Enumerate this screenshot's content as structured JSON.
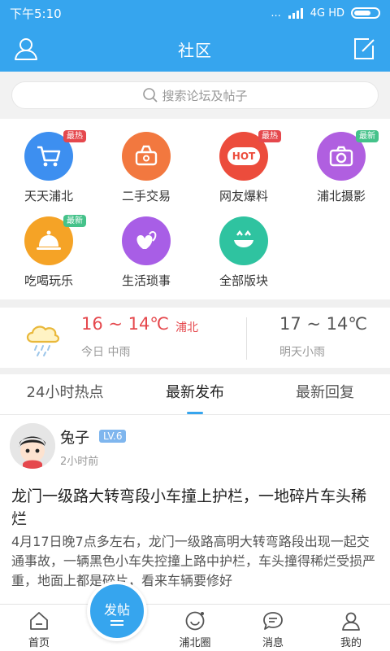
{
  "status_bar": {
    "time": "下午5:10",
    "dots": "...",
    "network": "4G HD"
  },
  "app_bar": {
    "title": "社区",
    "left_icon": "user-icon",
    "right_icon": "edit-icon"
  },
  "search": {
    "placeholder": "搜索论坛及帖子"
  },
  "forums": [
    {
      "label": "天天浦北",
      "badge": "最热",
      "icon": "cart-icon",
      "color": "#3d8ff0"
    },
    {
      "label": "二手交易",
      "badge": "",
      "icon": "basket-icon",
      "color": "#f2783f"
    },
    {
      "label": "网友爆料",
      "badge": "最热",
      "icon": "hot-icon",
      "color": "#ec4c3c",
      "icon_text": "HOT"
    },
    {
      "label": "浦北摄影",
      "badge": "最新",
      "icon": "camera-icon",
      "color": "#b05fe0"
    },
    {
      "label": "吃喝玩乐",
      "badge": "最新",
      "icon": "food-cloche-icon",
      "color": "#f5a326"
    },
    {
      "label": "生活琐事",
      "badge": "",
      "icon": "hearts-icon",
      "color": "#a85ee6"
    },
    {
      "label": "全部版块",
      "badge": "",
      "icon": "smile-icon",
      "color": "#2fc3a0"
    }
  ],
  "weather": {
    "icon": "rain-cloud-icon",
    "today": {
      "temp": "16 ~ 14℃",
      "city": "浦北",
      "desc": "今日 中雨"
    },
    "tomorrow": {
      "temp": "17 ~ 14℃",
      "desc": "明天小雨"
    }
  },
  "tabs": [
    {
      "label": "24小时热点",
      "active": false
    },
    {
      "label": "最新发布",
      "active": true
    },
    {
      "label": "最新回复",
      "active": false
    }
  ],
  "post": {
    "author": "兔子",
    "level": "LV.6",
    "time": "2小时前",
    "title": "龙门一级路大转弯段小车撞上护栏，一地碎片车头稀烂",
    "body": "4月17日晚7点多左右，龙门一级路高明大转弯路段出现一起交通事故，一辆黑色小车失控撞上路中护栏，车头撞得稀烂受损严重，地面上都是碎片，看来车辆要修好"
  },
  "bottom_nav": {
    "items": [
      {
        "label": "首页",
        "icon": "home-icon"
      },
      {
        "label": "浦北圈",
        "icon": "circle-smile-icon"
      },
      {
        "label": "消息",
        "icon": "message-icon"
      },
      {
        "label": "我的",
        "icon": "profile-icon"
      }
    ],
    "fab_label": "发帖"
  },
  "colors": {
    "primary": "#36a5ee",
    "hot_badge": "#e5484d",
    "new_badge": "#45c28a",
    "level_badge": "#7fb6ee"
  }
}
